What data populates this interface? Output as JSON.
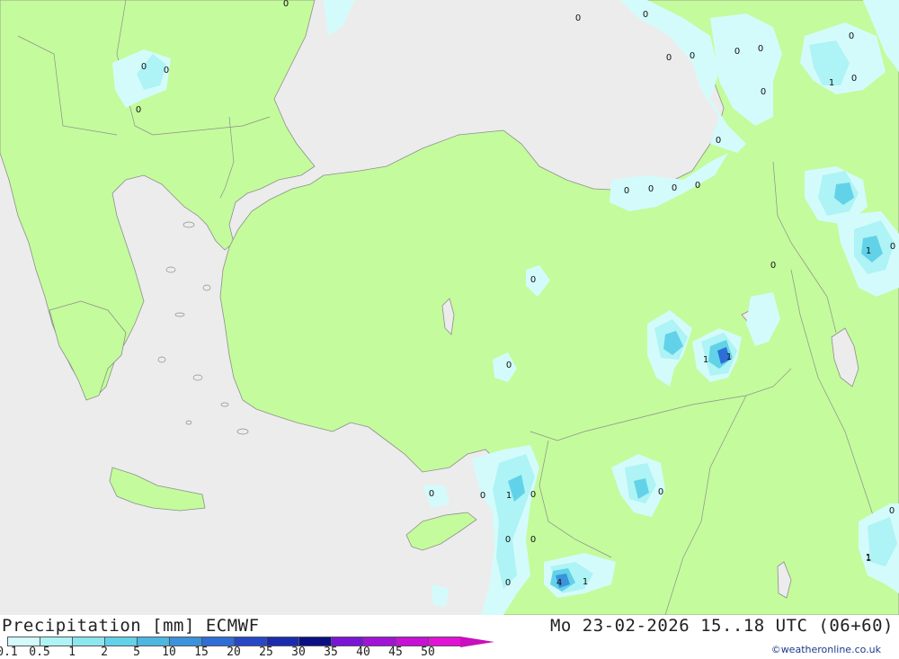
{
  "header": {
    "title": "Precipitation [mm] ECMWF",
    "datetime": "Mo 23-02-2026 15..18 UTC (06+60)",
    "credit": "©weatheronline.co.uk"
  },
  "legend": {
    "ticks": [
      "0.1",
      "0.5",
      "1",
      "2",
      "5",
      "10",
      "15",
      "20",
      "25",
      "30",
      "35",
      "40",
      "45",
      "50"
    ],
    "colors": [
      "#d4fbfb",
      "#aef3f5",
      "#8ae6ef",
      "#62d2e8",
      "#4cb7e2",
      "#3a93dc",
      "#2e6ed6",
      "#2547c8",
      "#1b2bb0",
      "#0b0f86",
      "#7a14d6",
      "#a312d8",
      "#c810d8",
      "#e312d6",
      "#c90ebb"
    ]
  },
  "map": {
    "land_color": "#c4fb9c",
    "sea_color": "#ececec",
    "point_labels": [
      "0",
      "0",
      "0",
      "0",
      "0",
      "0",
      "0",
      "0",
      "0",
      "0",
      "0",
      "0",
      "1",
      "0",
      "0",
      "0",
      "0",
      "0",
      "0",
      "0",
      "1",
      "0",
      "0",
      "0",
      "1",
      "1",
      "0",
      "0",
      "1",
      "0",
      "0",
      "0",
      "1",
      "4",
      "1",
      "0",
      "0",
      "1",
      "0"
    ]
  }
}
